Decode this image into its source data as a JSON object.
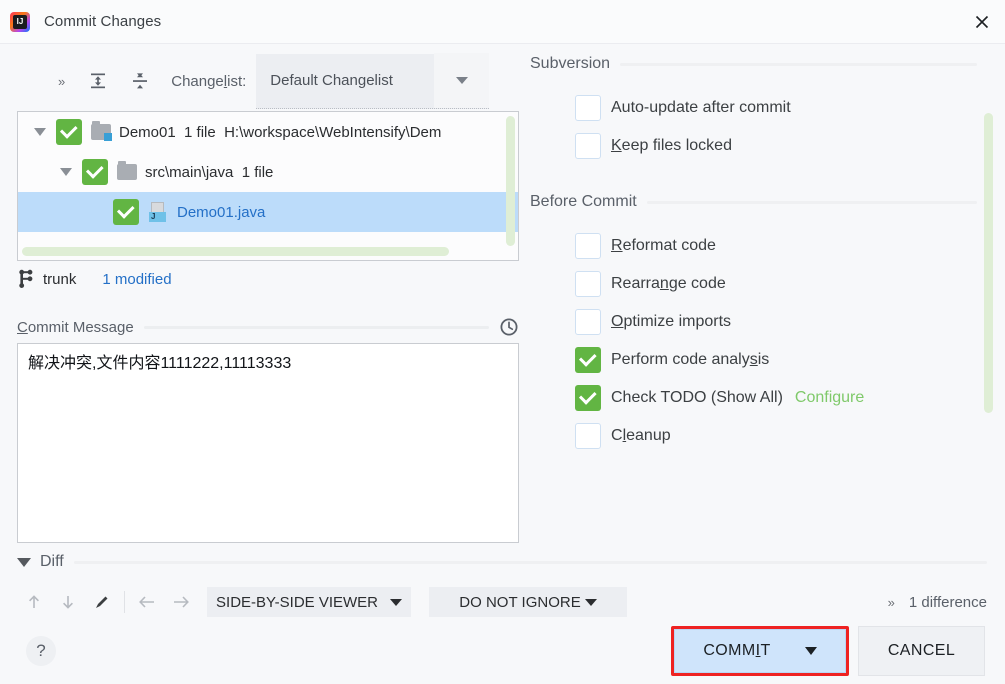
{
  "window": {
    "title": "Commit Changes",
    "app_icon": "intellij-idea-logo",
    "close_icon": "close-icon"
  },
  "changelist_toolbar": {
    "overflow_icon": "chevron-double-right-icon",
    "expand_all_icon": "expand-all-icon",
    "collapse_all_icon": "collapse-all-icon",
    "label": "Changelist:",
    "label_mnemonic": "l",
    "selected": "Default Changelist",
    "dropdown_icon": "chevron-down-icon"
  },
  "file_tree": {
    "rows": [
      {
        "name": "Demo01",
        "count": "1 file",
        "path": "H:\\workspace\\WebIntensify\\Dem",
        "checked": true,
        "expanded": true,
        "icon": "folder-module-icon",
        "selected": false,
        "depth": 0
      },
      {
        "name": "src\\main\\java",
        "count": "1 file",
        "path": "",
        "checked": true,
        "expanded": true,
        "icon": "folder-icon",
        "selected": false,
        "depth": 1
      },
      {
        "name": "Demo01.java",
        "count": "",
        "path": "",
        "checked": true,
        "expanded": null,
        "icon": "java-file-icon",
        "selected": true,
        "depth": 2
      }
    ]
  },
  "branch_bar": {
    "icon": "branch-icon",
    "branch": "trunk",
    "modified": "1 modified"
  },
  "commit_message": {
    "label": "Commit Message",
    "label_mnemonic": "C",
    "history_icon": "clock-history-icon",
    "value": "解决冲突,文件内容1111222,11113333",
    "placeholder": ""
  },
  "right_panel": {
    "sections": [
      {
        "title": "Subversion",
        "options": [
          {
            "label": "Auto-update after commit",
            "checked": false,
            "mnemonic": "",
            "link": ""
          },
          {
            "label": "Keep files locked",
            "checked": false,
            "mnemonic": "K",
            "link": ""
          }
        ]
      },
      {
        "title": "Before Commit",
        "options": [
          {
            "label": "Reformat code",
            "checked": false,
            "mnemonic": "R",
            "link": ""
          },
          {
            "label": "Rearrange code",
            "checked": false,
            "mnemonic": "n",
            "link": ""
          },
          {
            "label": "Optimize imports",
            "checked": false,
            "mnemonic": "O",
            "link": ""
          },
          {
            "label": "Perform code analysis",
            "checked": true,
            "mnemonic": "s",
            "link": ""
          },
          {
            "label": "Check TODO (Show All)",
            "checked": true,
            "mnemonic": "",
            "link": "Configure"
          },
          {
            "label": "Cleanup",
            "checked": false,
            "mnemonic": "l",
            "link": ""
          }
        ]
      }
    ],
    "scrollbar_color": "#dfeed5"
  },
  "diff": {
    "title": "Diff",
    "collapse_icon": "caret-down-icon",
    "toolbar": {
      "prev_change_icon": "arrow-up-icon",
      "next_change_icon": "arrow-down-icon",
      "edit_icon": "pencil-icon",
      "accept_left_icon": "arrow-left-icon",
      "accept_right_icon": "arrow-right-icon",
      "viewer_mode": "SIDE-BY-SIDE VIEWER",
      "whitespace_mode": "DO NOT IGNORE",
      "overflow_icon": "chevron-double-right-icon",
      "difference_count": "1 difference"
    }
  },
  "footer": {
    "help_label": "?",
    "commit_label": "COMMIT",
    "commit_mnemonic": "I",
    "commit_dropdown_icon": "triangle-down-icon",
    "cancel_label": "CANCEL",
    "highlight_color": "#ee2222",
    "commit_bg": "#cfe4fb"
  }
}
